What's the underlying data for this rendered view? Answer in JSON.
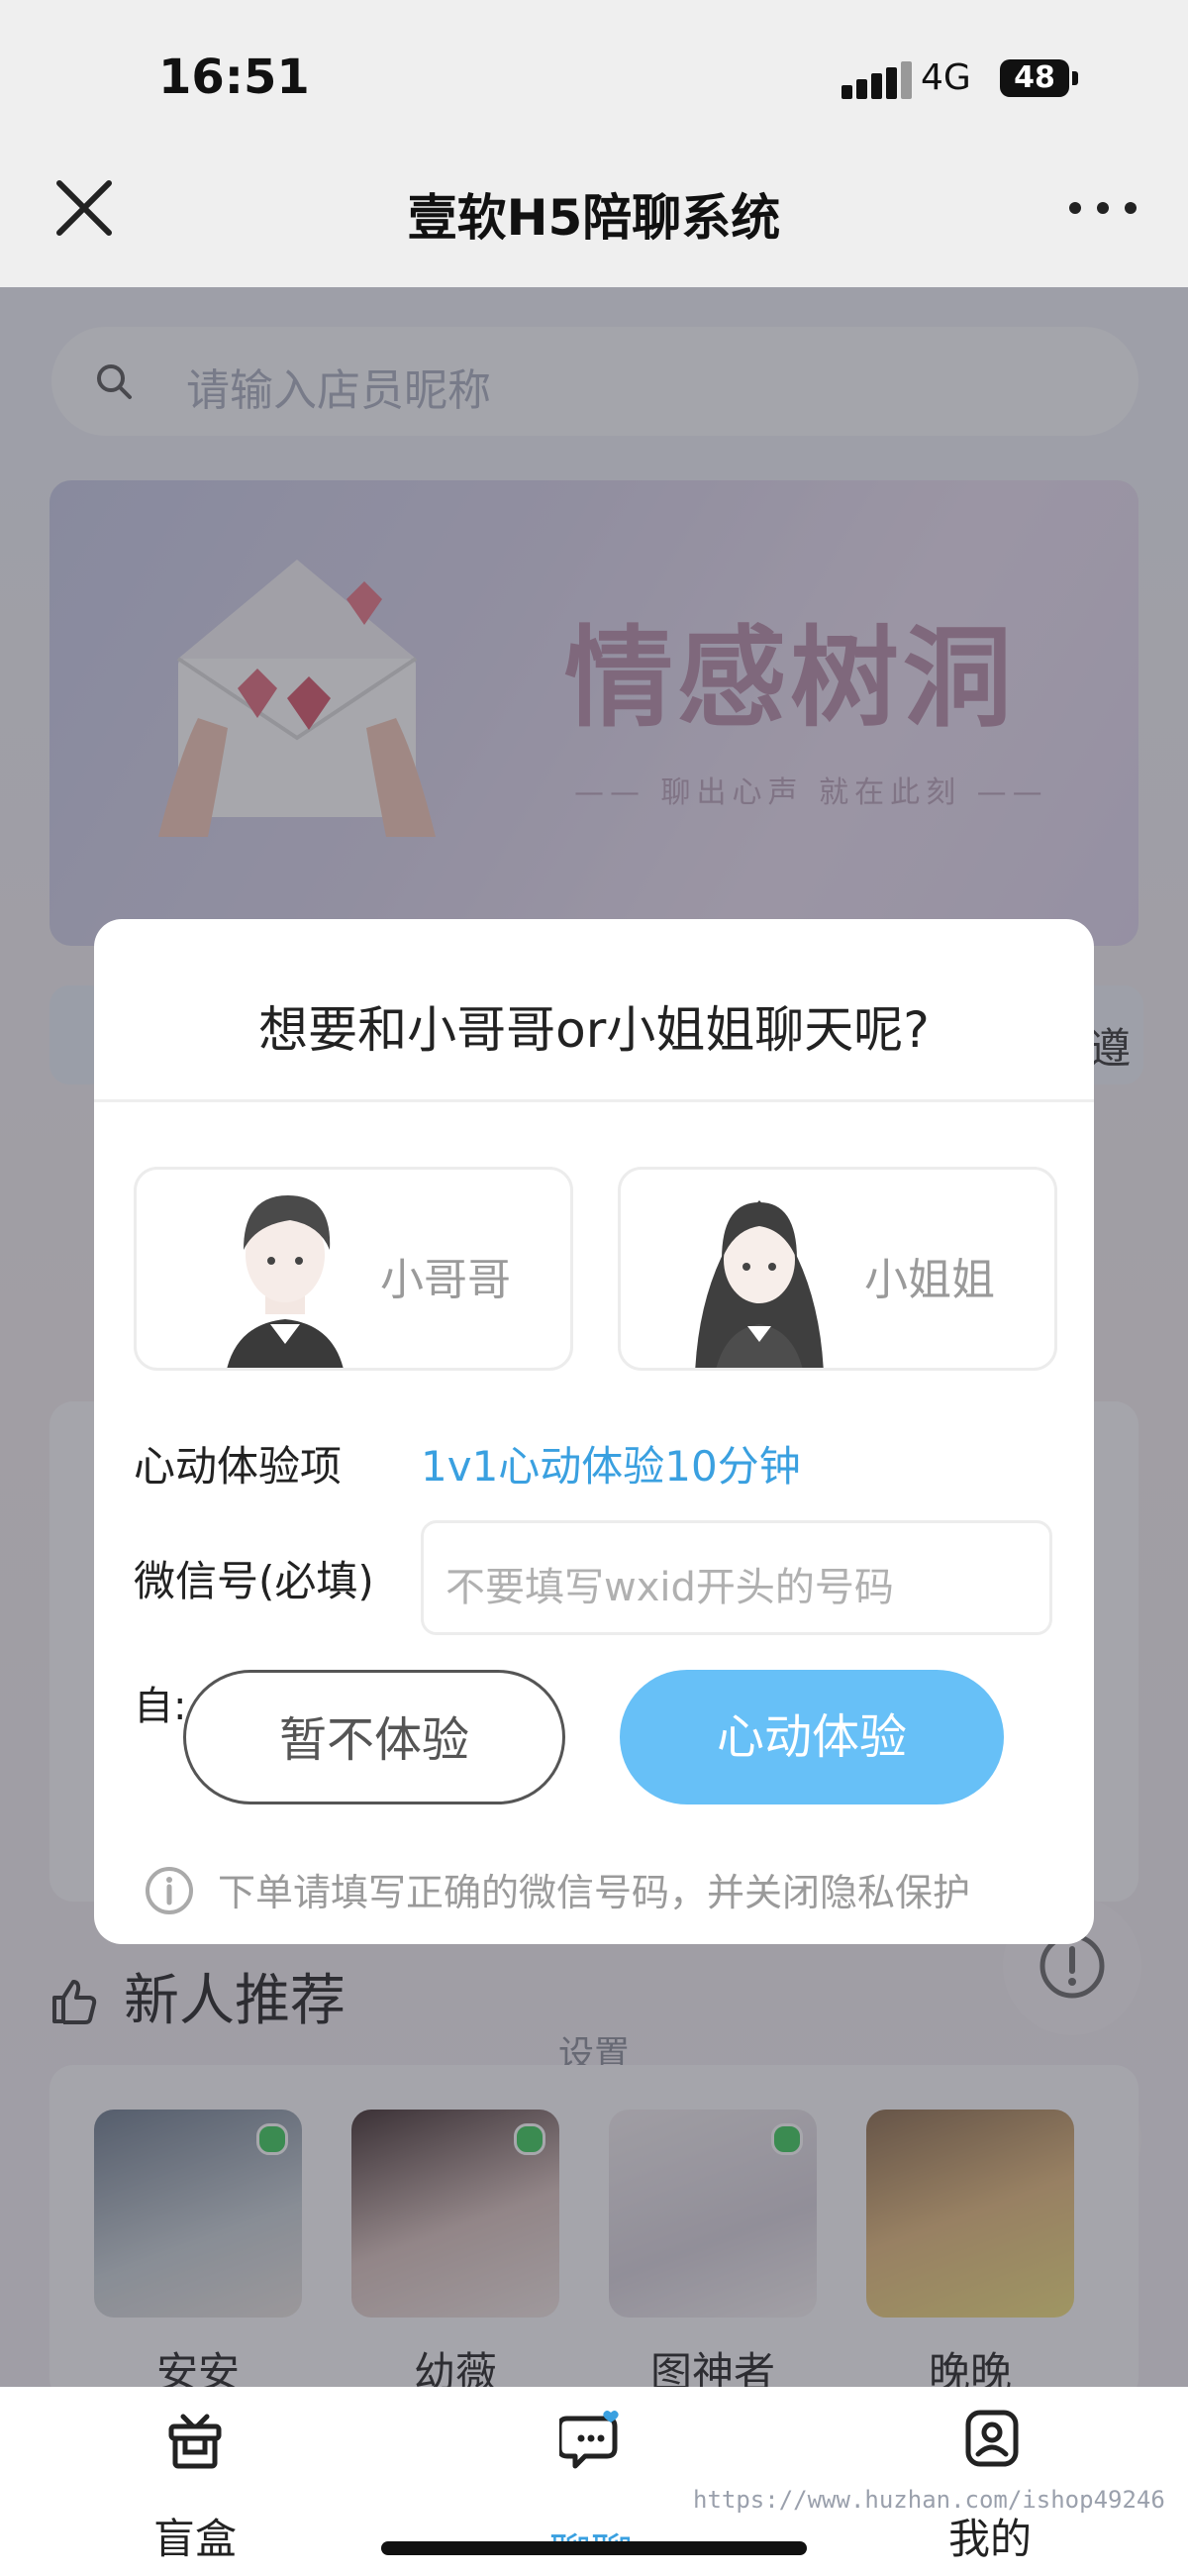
{
  "status_bar": {
    "time": "16:51",
    "network": "4G",
    "battery": "48"
  },
  "nav": {
    "title": "壹软H5陪聊系统"
  },
  "search": {
    "placeholder": "请输入店员昵称"
  },
  "banner": {
    "title": "情感树洞",
    "subtitle": "—— 聊出心声 就在此刻 ——"
  },
  "side_text": "遵",
  "section": {
    "new_title": "新人推荐",
    "settings_label": "设置"
  },
  "recommendations": [
    {
      "name": "安安",
      "online": true
    },
    {
      "name": "幼薇",
      "online": true
    },
    {
      "name": "图神者",
      "online": true
    },
    {
      "name": "晚晚",
      "online": false
    }
  ],
  "modal": {
    "title": "想要和小哥哥or小姐姐聊天呢?",
    "options": [
      {
        "label": "小哥哥"
      },
      {
        "label": "小姐姐"
      }
    ],
    "experience_label": "心动体验项",
    "experience_value": "1v1心动体验10分钟",
    "wechat_label": "微信号(必填)",
    "wechat_label_overflow": "自:",
    "wechat_placeholder": "不要填写wxid开头的号码",
    "cancel_button": "暂不体验",
    "confirm_button": "心动体验",
    "notice": "下单请填写正确的微信号码，并关闭隐私保护"
  },
  "tabbar": {
    "items": [
      {
        "label": "盲盒"
      },
      {
        "label": "聊聊"
      },
      {
        "label": "我的"
      }
    ]
  },
  "watermark": "https://www.huzhan.com/ishop49246",
  "colors": {
    "accent": "#67c0f7",
    "link": "#3aa0e0",
    "online": "#3bcc5a"
  }
}
